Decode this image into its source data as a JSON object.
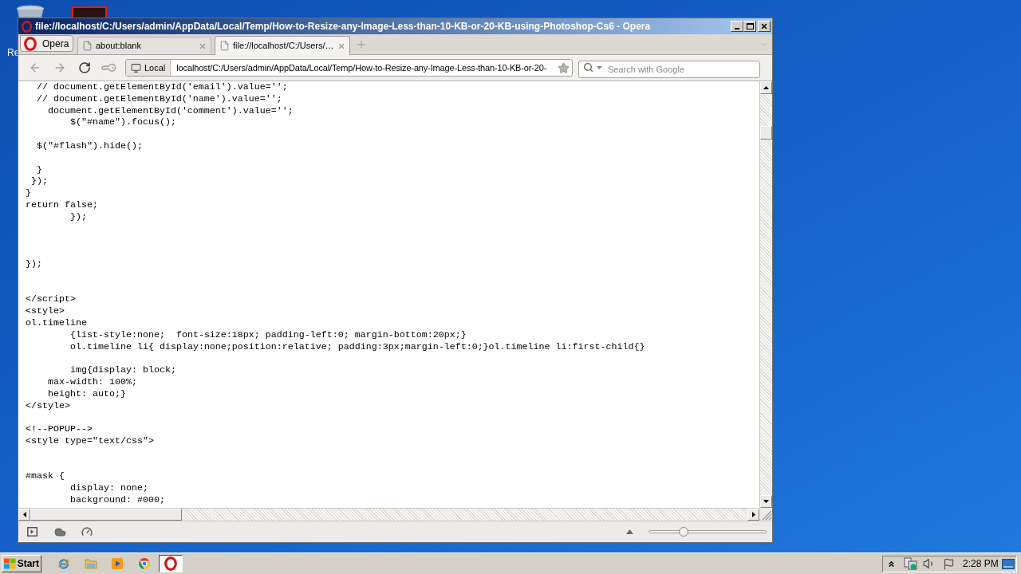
{
  "desktop": {
    "icon_label": "Re"
  },
  "window": {
    "title": "file://localhost/C:/Users/admin/AppData/Local/Temp/How-to-Resize-any-Image-Less-than-10-KB-or-20-KB-using-Photoshop-Cs6 - Opera"
  },
  "menu_button": {
    "label": "Opera"
  },
  "tabs": [
    {
      "title": "about:blank",
      "selected": false
    },
    {
      "title": "file://localhost/C:/Users/…",
      "selected": true
    }
  ],
  "toolbar": {
    "buttons": [
      {
        "kind": "back",
        "disabled": true
      },
      {
        "kind": "forward",
        "disabled": true
      },
      {
        "kind": "reload",
        "disabled": false
      },
      {
        "kind": "key",
        "disabled": true
      }
    ]
  },
  "address_bar": {
    "badge": "Local",
    "url": "localhost/C:/Users/admin/AppData/Local/Temp/How-to-Resize-any-Image-Less-than-10-KB-or-20-"
  },
  "search": {
    "placeholder": "Search with Google"
  },
  "page": {
    "lines": [
      {
        "kind": "code",
        "text": "  // document.getElementById('email').value='';"
      },
      {
        "kind": "code",
        "text": "  // document.getElementById('name').value='';"
      },
      {
        "kind": "code",
        "text": "    document.getElementById('comment').value='';"
      },
      {
        "kind": "code",
        "text": "        $(\"#name\").focus();"
      },
      {
        "kind": "blank"
      },
      {
        "kind": "code",
        "text": "  $(\"#flash\").hide();"
      },
      {
        "kind": "blank"
      },
      {
        "kind": "code",
        "text": "  }"
      },
      {
        "kind": "code",
        "text": " });"
      },
      {
        "kind": "code",
        "text": "}"
      },
      {
        "kind": "code",
        "text": "return false;"
      },
      {
        "kind": "code",
        "text": "        });"
      },
      {
        "kind": "blank"
      },
      {
        "kind": "blank"
      },
      {
        "kind": "blank"
      },
      {
        "kind": "code",
        "text": "});"
      },
      {
        "kind": "blank"
      },
      {
        "kind": "blank"
      },
      {
        "kind": "code",
        "text": "</script>"
      },
      {
        "kind": "code",
        "text": "<style>"
      },
      {
        "kind": "code",
        "text": "ol.timeline"
      },
      {
        "kind": "code",
        "text": "        {list-style:none;  font-size:18px; padding-left:0; margin-bottom:20px;}"
      },
      {
        "kind": "code",
        "text": "        ol.timeline li{ display:none;position:relative; padding:3px;margin-left:0;}ol.timeline li:first-child{}"
      },
      {
        "kind": "blank"
      },
      {
        "kind": "code",
        "text": "        img{display: block;"
      },
      {
        "kind": "code",
        "text": "    max-width: 100%;"
      },
      {
        "kind": "code",
        "text": "    height: auto;}"
      },
      {
        "kind": "code",
        "text": "</style>"
      },
      {
        "kind": "blank"
      },
      {
        "kind": "code",
        "text": "<!--POPUP-->"
      },
      {
        "kind": "code",
        "text": "<style type=\"text/css\">"
      },
      {
        "kind": "blank"
      },
      {
        "kind": "blank"
      },
      {
        "kind": "code",
        "text": "#mask {"
      },
      {
        "kind": "code",
        "text": "        display: none;"
      },
      {
        "kind": "code",
        "text": "        background: #000;"
      }
    ]
  },
  "status_bar": {
    "zoom": {
      "level": 0.28
    }
  },
  "taskbar": {
    "start": "Start",
    "apps": [
      {
        "kind": "e",
        "selected": false
      },
      {
        "kind": "folder",
        "selected": false
      },
      {
        "kind": "player",
        "selected": false
      },
      {
        "kind": "wheel",
        "selected": false
      },
      {
        "kind": "o",
        "selected": true
      }
    ],
    "clock": "2:28 PM"
  }
}
